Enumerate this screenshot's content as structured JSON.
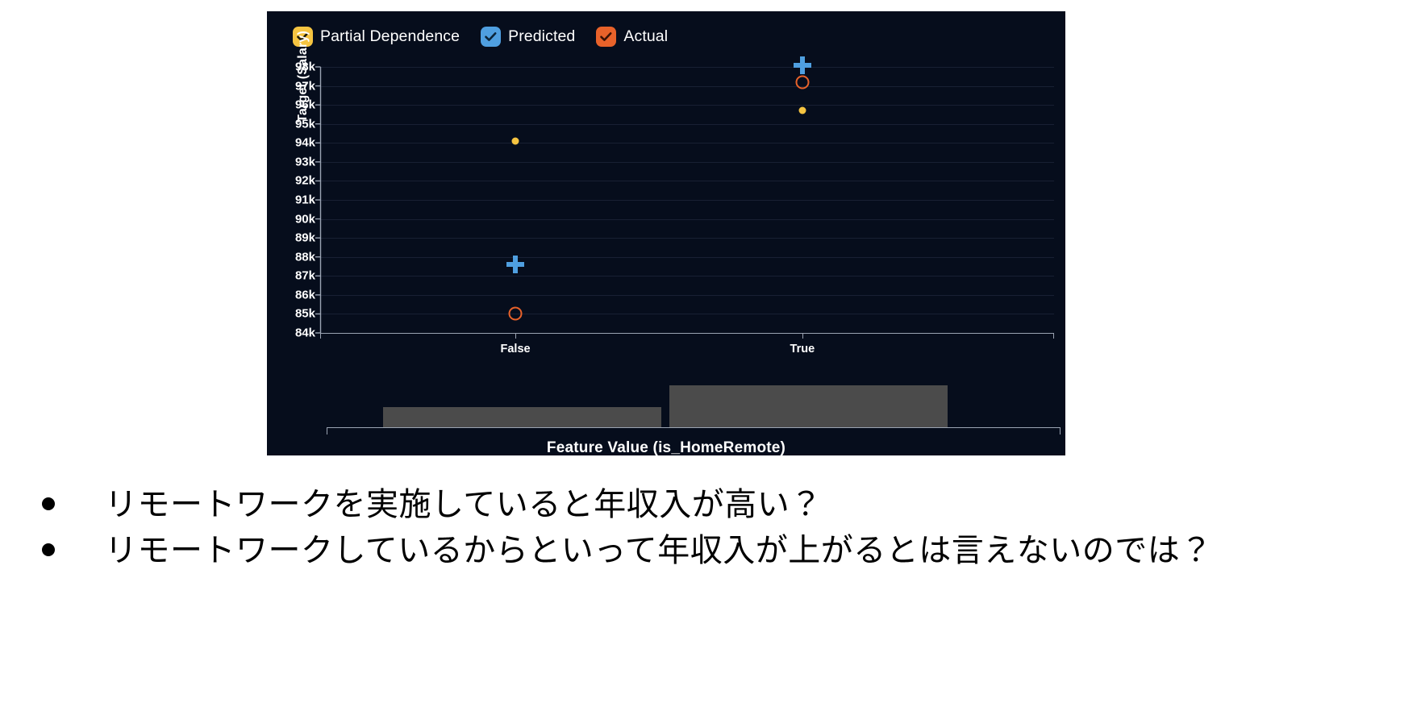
{
  "slide": {
    "background": "#ffffff",
    "bullets": [
      "リモートワークを実施していると年収入が高い？",
      "リモートワークしているからといって年収入が上がるとは言えないのでは？"
    ]
  },
  "chart_panel": {
    "background": "#060d1c"
  },
  "chart_data": {
    "type": "scatter",
    "title": "",
    "xlabel": "Feature Value (is_HomeRemote)",
    "ylabel": "Target (Salary)",
    "categories": [
      "False",
      "True"
    ],
    "ylim": [
      84000,
      98000
    ],
    "ytick_labels": [
      "98k",
      "97k",
      "96k",
      "95k",
      "94k",
      "93k",
      "92k",
      "91k",
      "90k",
      "89k",
      "88k",
      "87k",
      "86k",
      "85k",
      "84k"
    ],
    "ytick_values": [
      98000,
      97000,
      96000,
      95000,
      94000,
      93000,
      92000,
      91000,
      90000,
      89000,
      88000,
      87000,
      86000,
      85000,
      84000
    ],
    "grid": true,
    "legend_position": "top-left",
    "series": [
      {
        "name": "Partial Dependence",
        "color": "#f5c441",
        "marker": "dot",
        "enabled": true,
        "values": [
          94100,
          95700
        ]
      },
      {
        "name": "Predicted",
        "color": "#4f9fe0",
        "marker": "plus",
        "enabled": true,
        "values": [
          87600,
          98100
        ]
      },
      {
        "name": "Actual",
        "color": "#e8622a",
        "marker": "circle",
        "enabled": true,
        "values": [
          85000,
          97200
        ]
      }
    ],
    "histogram": {
      "color": "#4b4b4b",
      "categories": [
        "False",
        "True"
      ],
      "heights": [
        0.42,
        0.85
      ]
    }
  }
}
